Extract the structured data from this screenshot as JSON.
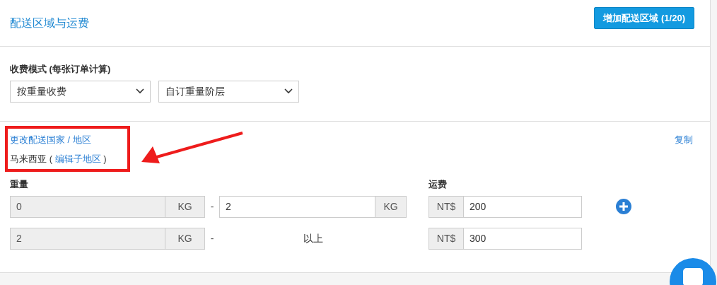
{
  "header": {
    "title": "配送区域与运费",
    "add_button": "增加配送区域 (1/20)"
  },
  "fee_mode": {
    "label": "收费模式 (每张订单计算)",
    "selects": [
      {
        "value": "按重量收费"
      },
      {
        "value": "自订重量阶层"
      }
    ]
  },
  "region": {
    "change_link": "更改配送国家 / 地区",
    "country": "马来西亚",
    "open": "(",
    "edit_link": "编辑子地区",
    "close": ")",
    "copy_link": "复制"
  },
  "weight_label": "重量",
  "fee_label": "运费",
  "rows": [
    {
      "kind": "range",
      "from": "0",
      "from_disabled": true,
      "unit": "KG",
      "dash": "-",
      "to": "2",
      "to_unit": "KG",
      "currency": "NT$",
      "fee": "200",
      "add": true
    },
    {
      "kind": "above",
      "from": "2",
      "from_disabled": true,
      "unit": "KG",
      "dash": "-",
      "to_text": "以上",
      "currency": "NT$",
      "fee": "300",
      "add": false
    }
  ]
}
